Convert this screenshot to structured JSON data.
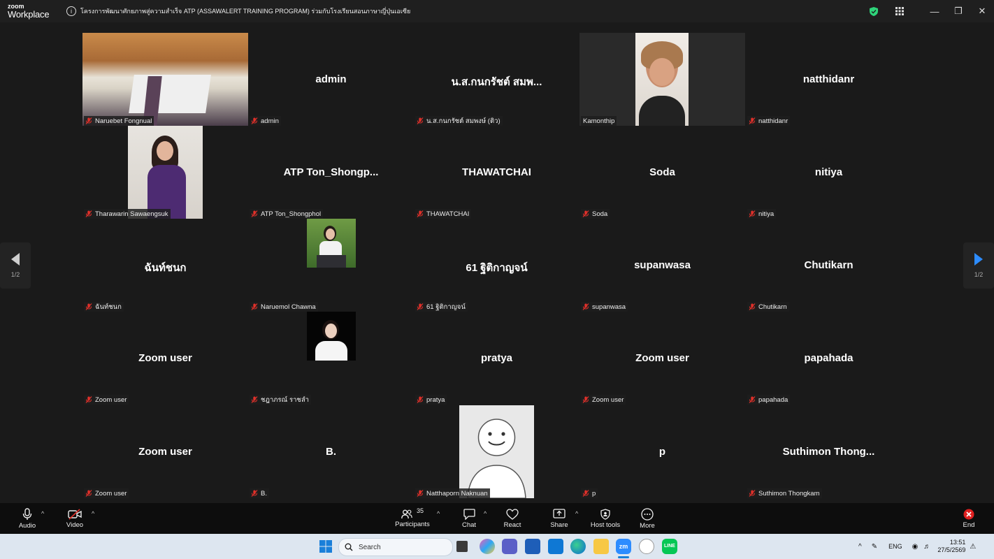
{
  "titlebar": {
    "logo_line1": "zoom",
    "logo_line2": "Workplace",
    "meeting_title": "โครงการพัฒนาศักยภาพสู่ความสำเร็จ ATP (ASSAWALERT TRAINING PROGRAM) ร่วมกับโรงเรียนสอนภาษาญี่ปุ่นเอเซีย",
    "icons": [
      "info-icon",
      "shield-check-icon",
      "grid-icon",
      "minimize-icon",
      "restore-icon",
      "close-icon"
    ]
  },
  "gallery": {
    "page_indicator_left": "1/2",
    "page_indicator_right": "1/2",
    "tiles": [
      {
        "label": "Naruebet Fongnual",
        "center": "",
        "media": "room-video"
      },
      {
        "label": "admin",
        "center": "admin"
      },
      {
        "label": "น.ส.กนกรัชต์ สมพงษ์ (ติว)",
        "center": "น.ส.กนกรัชต์ สมพ..."
      },
      {
        "label": "Kamonthip",
        "center": "",
        "media": "face-video",
        "active": true
      },
      {
        "label": "natthidanr",
        "center": "natthidanr"
      },
      {
        "label": "Tharawarin Sawaengsuk",
        "center": "",
        "media": "photo-purple"
      },
      {
        "label": "ATP Ton_Shongphol",
        "center": "ATP  Ton_Shongp..."
      },
      {
        "label": "THAWATCHAI",
        "center": "THAWATCHAI"
      },
      {
        "label": "Soda",
        "center": "Soda"
      },
      {
        "label": "nitiya",
        "center": "nitiya"
      },
      {
        "label": "ฉันท์ชนก",
        "center": "ฉันท์ชนก"
      },
      {
        "label": "Naruemol Chawna",
        "center": "",
        "media": "photo-green"
      },
      {
        "label": "61 ฐิติกาญจน์",
        "center": "61 ฐิติกาญจน์"
      },
      {
        "label": "supanwasa",
        "center": "supanwasa"
      },
      {
        "label": "Chutikarn",
        "center": "Chutikarn"
      },
      {
        "label": "Zoom user",
        "center": "Zoom user"
      },
      {
        "label": "ชฎาภรณ์ ราชลำ",
        "center": "",
        "media": "photo-dark"
      },
      {
        "label": "pratya",
        "center": "pratya"
      },
      {
        "label": "Zoom user",
        "center": "Zoom user"
      },
      {
        "label": "papahada",
        "center": "papahada"
      },
      {
        "label": "Zoom user",
        "center": "Zoom user"
      },
      {
        "label": "B.",
        "center": "B."
      },
      {
        "label": "Natthaporn Naknuan",
        "center": "",
        "media": "avatar-default"
      },
      {
        "label": "p",
        "center": "p"
      },
      {
        "label": "Suthimon Thongkam",
        "center": "Suthimon  Thong..."
      }
    ]
  },
  "toolbar": {
    "audio": "Audio",
    "video": "Video",
    "participants": "Participants",
    "participants_count": "35",
    "chat": "Chat",
    "react": "React",
    "share": "Share",
    "host_tools": "Host tools",
    "more": "More",
    "end": "End"
  },
  "taskbar": {
    "search_placeholder": "Search",
    "lang": "ENG",
    "time": "13:51",
    "date": "27/5/2569"
  },
  "colors": {
    "active_speaker": "#2ed47a",
    "end_red": "#e02020",
    "mute_red": "#e0302a",
    "nav_arrow": "#2d8cff"
  }
}
